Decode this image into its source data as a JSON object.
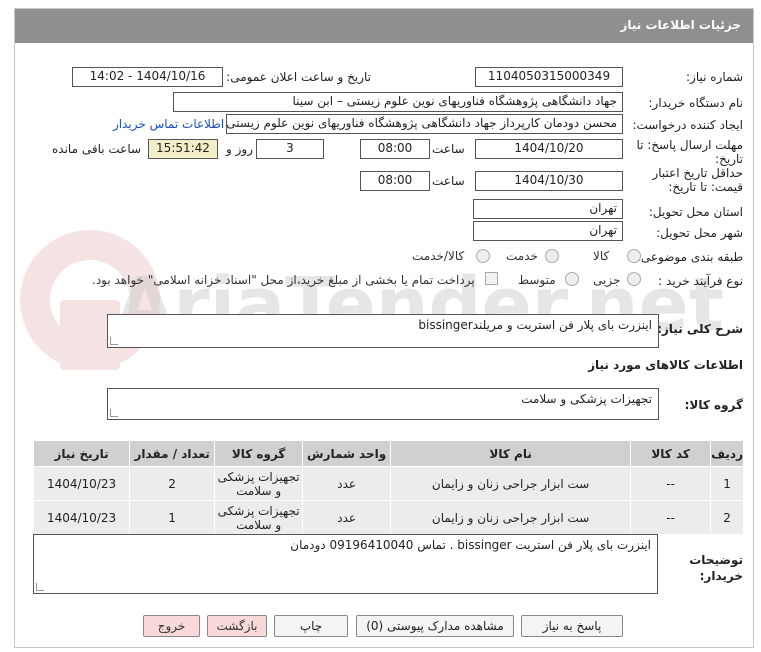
{
  "header": {
    "title": "جزئیات اطلاعات نیاز"
  },
  "form": {
    "need_number_label": "شماره نیاز:",
    "need_number": "1104050315000349",
    "announce_label": "تاریخ و ساعت اعلان عمومی:",
    "announce_value": "1404/10/16 - 14:02",
    "buyer_org_label": "نام دستگاه خریدار:",
    "buyer_org": "جهاد دانشگاهی پژوهشگاه فناوریهای نوین علوم زیستی – ابن سینا",
    "requester_label": "ایجاد کننده درخواست:",
    "requester": "محسن دودمان کارپرداز جهاد دانشگاهی پژوهشگاه فناوریهای نوین علوم زیستی",
    "contact_link": "اطلاعات تماس خریدار",
    "reply_deadline_label": "مهلت ارسال پاسخ: تا تاریخ:",
    "reply_date": "1404/10/20",
    "time_label": "ساعت",
    "reply_time": "08:00",
    "days_value": "3",
    "days_label": "روز و",
    "remaining_time": "15:51:42",
    "remaining_label": "ساعت باقی مانده",
    "validity_label": "حداقل تاریخ اعتبار قیمت: تا تاریخ:",
    "validity_date": "1404/10/30",
    "validity_time": "08:00",
    "province_label": "استان محل تحویل:",
    "province": "تهران",
    "city_label": "شهر محل تحویل:",
    "city": "تهران",
    "category_label": "طبقه بندی موضوعی:",
    "category_options": [
      "کالا",
      "خدمت",
      "کالا/خدمت"
    ],
    "process_label": "نوع فرآیند خرید :",
    "process_options": [
      "جزیی",
      "متوسط"
    ],
    "payment_note": "پرداخت تمام یا بخشی از مبلغ خرید،از محل \"اسناد خزانه اسلامی\" خواهد بود."
  },
  "description": {
    "label": "شرح کلی نیاز:",
    "value": "اینزرت بای پلار فن استریت  و مریلندbissinger"
  },
  "goods": {
    "section_title": "اطلاعات کالاهای مورد نیاز",
    "group_label": "گروه کالا:",
    "group_value": "تجهیزات پزشکی و سلامت",
    "columns": [
      "ردیف",
      "کد کالا",
      "نام کالا",
      "واحد شمارش",
      "گروه کالا",
      "تعداد / مقدار",
      "تاریخ نیاز"
    ],
    "rows": [
      [
        "1",
        "--",
        "ست ابزار جراحی زنان و زایمان",
        "عدد",
        "تجهیزات پزشکی و سلامت",
        "2",
        "1404/10/23"
      ],
      [
        "2",
        "--",
        "ست ابزار جراحی زنان و زایمان",
        "عدد",
        "تجهیزات پزشکی و سلامت",
        "1",
        "1404/10/23"
      ]
    ]
  },
  "buyer_notes": {
    "label": "توضیحات خریدار:",
    "value": "اینزرت بای پلار فن استریت bissinger . تماس 09196410040 دودمان"
  },
  "buttons": {
    "reply": "پاسخ به نیاز",
    "attachments": "مشاهده مدارک پیوستی (0)",
    "print": "چاپ",
    "back": "بازگشت",
    "exit": "خروج"
  },
  "watermark": "AriaTender.net"
}
